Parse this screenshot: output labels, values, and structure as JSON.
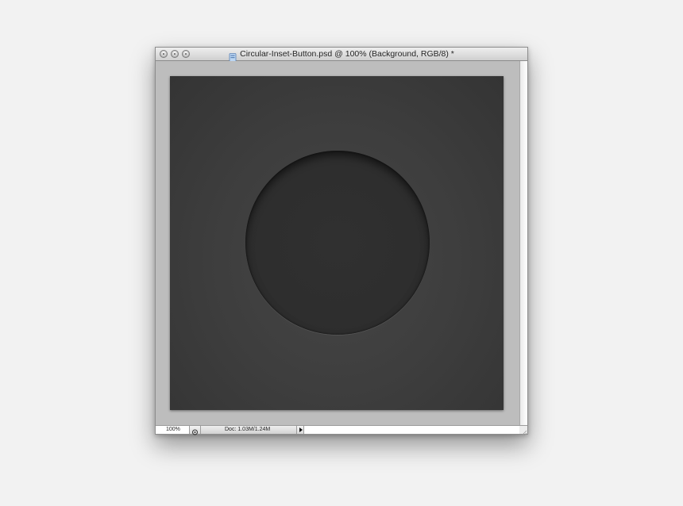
{
  "window": {
    "title": "Circular-Inset-Button.psd @ 100% (Background, RGB/8) *",
    "controls": [
      "close-icon",
      "minimize-icon",
      "zoom-icon"
    ]
  },
  "status": {
    "zoom": "100%",
    "doc_info": "Doc: 1.03M/1.24M"
  },
  "colors": {
    "canvas": "#3d3d3d",
    "button": "#2e2e2e",
    "window_frame": "#bdbdbd"
  }
}
